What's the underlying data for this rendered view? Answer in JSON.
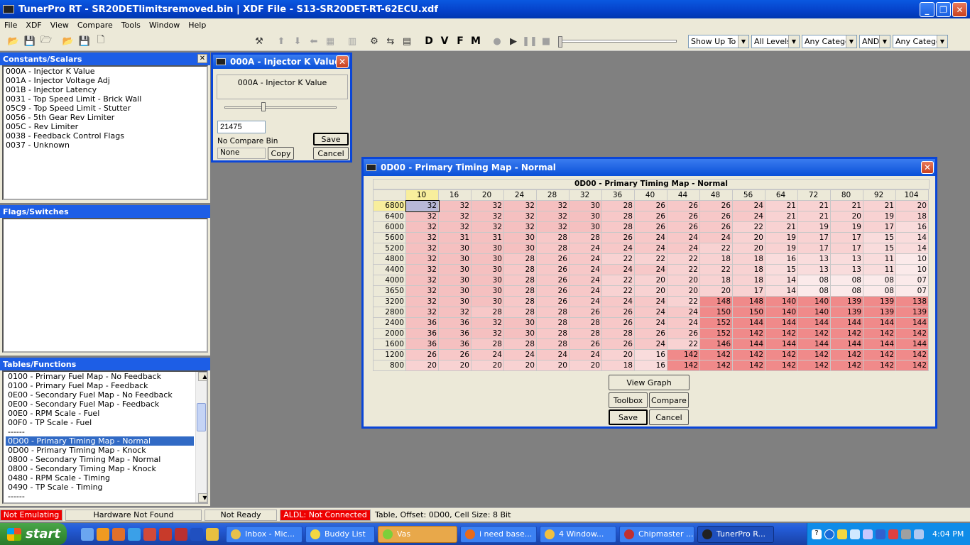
{
  "app": {
    "title": "TunerPro RT - SR20DETlimitsremoved.bin | XDF File - S13-SR20DET-RT-62ECU.xdf"
  },
  "menu": [
    "File",
    "XDF",
    "View",
    "Compare",
    "Tools",
    "Window",
    "Help"
  ],
  "toolbar": {
    "letters": [
      "D",
      "V",
      "F",
      "M"
    ],
    "dropdowns": [
      {
        "value": "Show Up To",
        "w": 86
      },
      {
        "value": "All Levels",
        "w": 68
      },
      {
        "value": "Any Categor",
        "w": 78
      },
      {
        "value": "AND",
        "w": 44
      },
      {
        "value": "Any Categor",
        "w": 78
      }
    ]
  },
  "constants": {
    "header": "Constants/Scalars",
    "items": [
      "000A - Injector K Value",
      "001A - Injector Voltage Adj",
      "001B - Injector Latency",
      "0031 - Top Speed Limit - Brick Wall",
      "05C9 - Top Speed Limit - Stutter",
      "0056 - 5th Gear Rev Limiter",
      "005C - Rev Limiter",
      "0038 - Feedback Control Flags",
      "0037 - Unknown"
    ]
  },
  "flags": {
    "header": "Flags/Switches"
  },
  "tables": {
    "header": "Tables/Functions",
    "items": [
      "0100 - Primary Fuel Map - No Feedback",
      "0100 - Primary Fuel Map - Feedback",
      "0E00 - Secondary Fuel Map - No Feedback",
      "0E00 - Secondary Fuel Map - Feedback",
      "00E0 - RPM Scale - Fuel",
      "00F0 - TP Scale - Fuel",
      "------",
      "0D00 - Primary Timing Map - Normal",
      "0D00 - Primary Timing Map - Knock",
      "0800 - Secondary Timing Map - Normal",
      "0800 - Secondary Timing Map - Knock",
      "0480 - RPM Scale - Timing",
      "0490 - TP Scale - Timing",
      "------"
    ],
    "selected": 7
  },
  "scalar_win": {
    "title": "000A - Injector K Value",
    "label": "000A - Injector K Value",
    "value": "21475",
    "slider": 0.35,
    "compare_label": "No Compare Bin",
    "compare_value": "None",
    "copy": "Copy",
    "save": "Save",
    "cancel": "Cancel"
  },
  "map_win": {
    "title": "0D00 - Primary Timing Map - Normal",
    "table_title": "0D00 - Primary Timing Map - Normal",
    "cols": [
      "10",
      "16",
      "20",
      "24",
      "28",
      "32",
      "36",
      "40",
      "44",
      "48",
      "56",
      "64",
      "72",
      "80",
      "92",
      "104"
    ],
    "rows": [
      "6800",
      "6400",
      "6000",
      "5600",
      "5200",
      "4800",
      "4400",
      "4000",
      "3650",
      "3200",
      "2800",
      "2400",
      "2000",
      "1600",
      "1200",
      "800"
    ],
    "cells": [
      [
        "32",
        "32",
        "32",
        "32",
        "32",
        "30",
        "28",
        "26",
        "26",
        "26",
        "24",
        "21",
        "21",
        "21",
        "21",
        "20"
      ],
      [
        "32",
        "32",
        "32",
        "32",
        "32",
        "30",
        "28",
        "26",
        "26",
        "26",
        "24",
        "21",
        "21",
        "20",
        "19",
        "18"
      ],
      [
        "32",
        "32",
        "32",
        "32",
        "32",
        "30",
        "28",
        "26",
        "26",
        "26",
        "22",
        "21",
        "19",
        "19",
        "17",
        "16"
      ],
      [
        "32",
        "31",
        "31",
        "30",
        "28",
        "28",
        "26",
        "24",
        "24",
        "24",
        "20",
        "19",
        "17",
        "17",
        "15",
        "14"
      ],
      [
        "32",
        "30",
        "30",
        "30",
        "28",
        "24",
        "24",
        "24",
        "24",
        "22",
        "20",
        "19",
        "17",
        "17",
        "15",
        "14"
      ],
      [
        "32",
        "30",
        "30",
        "28",
        "26",
        "24",
        "22",
        "22",
        "22",
        "18",
        "18",
        "16",
        "13",
        "13",
        "11",
        "10"
      ],
      [
        "32",
        "30",
        "30",
        "28",
        "26",
        "24",
        "24",
        "24",
        "22",
        "22",
        "18",
        "15",
        "13",
        "13",
        "11",
        "10"
      ],
      [
        "32",
        "30",
        "30",
        "28",
        "26",
        "24",
        "22",
        "20",
        "20",
        "18",
        "18",
        "14",
        "08",
        "08",
        "08",
        "07"
      ],
      [
        "32",
        "30",
        "30",
        "28",
        "26",
        "24",
        "22",
        "20",
        "20",
        "20",
        "17",
        "14",
        "08",
        "08",
        "08",
        "07"
      ],
      [
        "32",
        "30",
        "30",
        "28",
        "26",
        "24",
        "24",
        "24",
        "22",
        "148",
        "148",
        "140",
        "140",
        "139",
        "139",
        "138"
      ],
      [
        "32",
        "32",
        "28",
        "28",
        "28",
        "26",
        "26",
        "24",
        "24",
        "150",
        "150",
        "140",
        "140",
        "139",
        "139",
        "139"
      ],
      [
        "36",
        "36",
        "32",
        "30",
        "28",
        "28",
        "26",
        "24",
        "24",
        "152",
        "144",
        "144",
        "144",
        "144",
        "144",
        "144"
      ],
      [
        "36",
        "36",
        "32",
        "30",
        "28",
        "28",
        "28",
        "26",
        "26",
        "152",
        "142",
        "142",
        "142",
        "142",
        "142",
        "142"
      ],
      [
        "36",
        "36",
        "28",
        "28",
        "28",
        "26",
        "26",
        "24",
        "22",
        "146",
        "144",
        "144",
        "144",
        "144",
        "144",
        "144"
      ],
      [
        "26",
        "26",
        "24",
        "24",
        "24",
        "24",
        "20",
        "16",
        "142",
        "142",
        "142",
        "142",
        "142",
        "142",
        "142",
        "142"
      ],
      [
        "20",
        "20",
        "20",
        "20",
        "20",
        "20",
        "18",
        "16",
        "142",
        "142",
        "142",
        "142",
        "142",
        "142",
        "142",
        "142"
      ]
    ],
    "highlight": {
      "col": 0,
      "row": 0
    },
    "view_graph": "View Graph",
    "toolbox": "Toolbox",
    "compare": "Compare",
    "save": "Save",
    "cancel": "Cancel"
  },
  "status": {
    "emulating": "Not Emulating",
    "hardware": "Hardware Not Found",
    "ready": "Not Ready",
    "aldl": "ALDL: Not Connected",
    "info": "Table, Offset: 0D00, Cell Size: 8 Bit"
  },
  "taskbar": {
    "start": "start",
    "tasks": [
      {
        "label": "Inbox - Mic...",
        "color": "#e8c14a"
      },
      {
        "label": "Buddy List",
        "color": "#f4d742"
      },
      {
        "label": "Vas",
        "color": "#7ccf3a"
      },
      {
        "label": "i need base...",
        "color": "#e86a1a"
      },
      {
        "label": "4 Window...",
        "color": "#f0c040"
      },
      {
        "label": "Chipmaster ...",
        "color": "#c03030"
      },
      {
        "label": "TunerPro R...",
        "color": "#222222"
      }
    ],
    "active": 6,
    "clock": "4:04 PM"
  }
}
